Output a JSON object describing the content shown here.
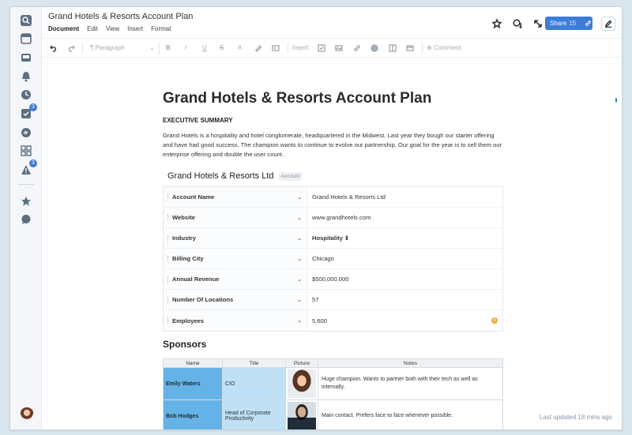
{
  "doc_title": "Grand Hotels & Resorts Account Plan",
  "menu": [
    "Document",
    "Edit",
    "View",
    "Insert",
    "Format"
  ],
  "share": {
    "label": "Share",
    "count": "15"
  },
  "rail_badges": {
    "tasks": "3",
    "alerts": "3"
  },
  "toolbar": {
    "style_label": "Paragraph",
    "insert_label": "Insert:",
    "comment_label": "Comment"
  },
  "page": {
    "heading": "Grand Hotels & Resorts Account Plan",
    "section_label": "EXECUTIVE SUMMARY",
    "summary": "Grand Hotels is a hospitality and hotel conglomerate, headquartered in the Midwest. Last year they bough our starter offering and have had good success. The champion wants to continue to evolve our partnership. Our goal for the year is to sell them our enterprise offering and double the user count."
  },
  "account": {
    "name": "Grand Hotels & Resorts Ltd",
    "tag": "Account",
    "fields": [
      {
        "label": "Account Name",
        "value": "Grand Hotels & Resorts Ltd"
      },
      {
        "label": "Website",
        "value": "www.grandhotels.com"
      },
      {
        "label": "Industry",
        "value": "Hospitality ⇕"
      },
      {
        "label": "Billing City",
        "value": "Chicago"
      },
      {
        "label": "Annual Revenue",
        "value": "$500,000,000"
      },
      {
        "label": "Number Of Locations",
        "value": "57"
      },
      {
        "label": "Employees",
        "value": "5,600"
      }
    ],
    "employees_badge": "5"
  },
  "sponsors": {
    "heading": "Sponsors",
    "columns": [
      "Name",
      "Title",
      "Picture",
      "Notes"
    ],
    "rows": [
      {
        "name": "Emily Waters",
        "title": "CIO",
        "notes": "Huge champion. Wants to partner both with their tech as well as internally."
      },
      {
        "name": "Bob Hodges",
        "title": "Head of Corporate Productivity",
        "notes": "Main contact. Prefers face to face whenever possible."
      }
    ]
  },
  "last_updated": "Last updated 18 mins ago",
  "colors": {
    "accent": "#3b7dd8",
    "name_cell": "#65b3e6",
    "title_cell": "#bfe0f5"
  }
}
